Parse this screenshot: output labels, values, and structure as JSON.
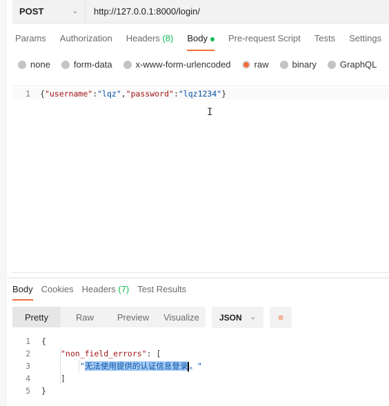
{
  "request": {
    "method": "POST",
    "url": "http://127.0.0.1:8000/login/"
  },
  "tabs": [
    {
      "label": "Params"
    },
    {
      "label": "Authorization"
    },
    {
      "label": "Headers",
      "count": "(8)"
    },
    {
      "label": "Body"
    },
    {
      "label": "Pre-request Script"
    },
    {
      "label": "Tests"
    },
    {
      "label": "Settings"
    }
  ],
  "body_types": [
    "none",
    "form-data",
    "x-www-form-urlencoded",
    "raw",
    "binary",
    "GraphQL"
  ],
  "selected_body_type": "raw",
  "editor": {
    "line": "1",
    "k1": "\"username\"",
    "v1": "\"lqz\"",
    "k2": "\"password\"",
    "v2": "\"lqz1234\""
  },
  "response": {
    "tabs": [
      {
        "label": "Body"
      },
      {
        "label": "Cookies"
      },
      {
        "label": "Headers",
        "count": "(7)"
      },
      {
        "label": "Test Results"
      }
    ],
    "views": [
      "Pretty",
      "Raw",
      "Preview",
      "Visualize"
    ],
    "format": "JSON",
    "lines": [
      "1",
      "2",
      "3",
      "4",
      "5"
    ],
    "key": "\"non_field_errors\"",
    "message": "无法使用提供的认证信息登录",
    "message_tail": "。"
  },
  "colors": {
    "accent": "#f26b3a",
    "green": "#0cbb52"
  }
}
